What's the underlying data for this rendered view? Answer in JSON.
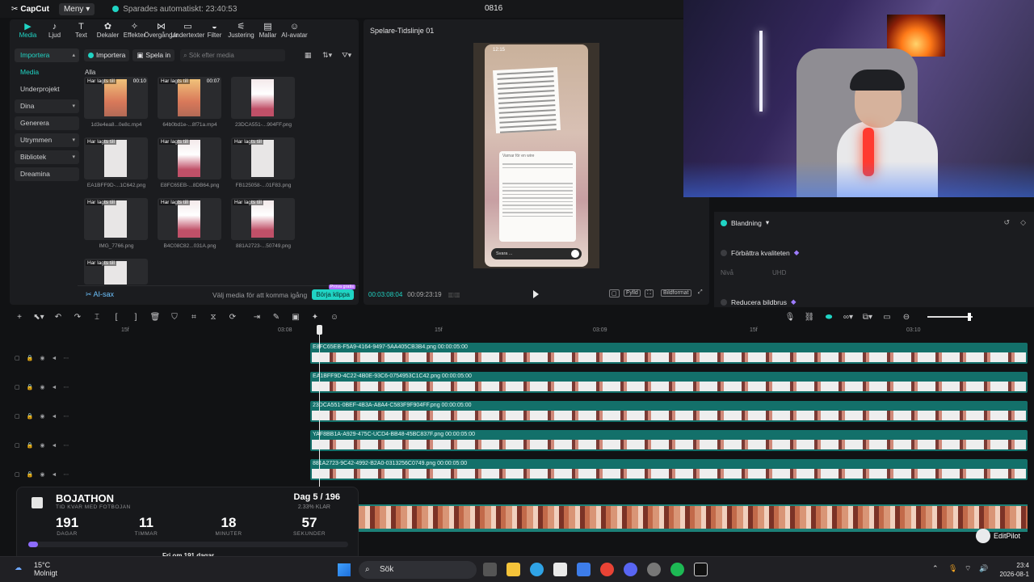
{
  "app": {
    "logo": "CapCut",
    "menu_label": "Meny",
    "autosave": "Sparades automatiskt: 23:40:53",
    "project_title": "0816"
  },
  "toolbar": [
    {
      "label": "Media",
      "icon": "media-icon",
      "active": true
    },
    {
      "label": "Ljud",
      "icon": "audio-icon"
    },
    {
      "label": "Text",
      "icon": "text-icon"
    },
    {
      "label": "Dekaler",
      "icon": "sticker-icon"
    },
    {
      "label": "Effekter",
      "icon": "effects-icon"
    },
    {
      "label": "Övergångar",
      "icon": "transitions-icon"
    },
    {
      "label": "Undertexter",
      "icon": "captions-icon"
    },
    {
      "label": "Filter",
      "icon": "filter-icon"
    },
    {
      "label": "Justering",
      "icon": "adjust-icon"
    },
    {
      "label": "Mallar",
      "icon": "templates-icon"
    },
    {
      "label": "AI-avatar",
      "icon": "avatar-icon"
    }
  ],
  "side_nav": [
    {
      "label": "Importera",
      "state": "open"
    },
    {
      "label": "Media",
      "state": "sel"
    },
    {
      "label": "Underprojekt",
      "state": ""
    },
    {
      "label": "Dina",
      "state": "boxed"
    },
    {
      "label": "Generera",
      "state": "boxed"
    },
    {
      "label": "Utrymmen",
      "state": "boxed"
    },
    {
      "label": "Bibliotek",
      "state": "boxed"
    },
    {
      "label": "Dreamina",
      "state": "boxed"
    }
  ],
  "media_bar": {
    "import_label": "Importera",
    "play_label": "Spela in",
    "search_placeholder": "Sök efter media",
    "group_label": "Alla"
  },
  "media_items": [
    {
      "tag": "Har lagts till",
      "duration": "00:10",
      "name": "1d3e4ea8...0e8c.mp4",
      "kind": "photo"
    },
    {
      "tag": "Har lagts till",
      "duration": "00:07",
      "name": "64b0bd1e-...8f71a.mp4",
      "kind": "photo"
    },
    {
      "tag": "",
      "duration": "",
      "name": "23DCA551-...904FF.png",
      "kind": "pink"
    },
    {
      "tag": "Har lagts till",
      "duration": "",
      "name": "EA1BFF9D-...1C642.png",
      "kind": "doc"
    },
    {
      "tag": "Har lagts till",
      "duration": "",
      "name": "E8FC65EB-...8DB64.png",
      "kind": "pink"
    },
    {
      "tag": "Har lagts till",
      "duration": "",
      "name": "FB125058-...01F83.png",
      "kind": "doc"
    },
    {
      "tag": "Har lagts till",
      "duration": "",
      "name": "IMG_7766.png",
      "kind": "doc"
    },
    {
      "tag": "Har lagts till",
      "duration": "",
      "name": "B4C08C82...031A.png",
      "kind": "pink"
    },
    {
      "tag": "Har lagts till",
      "duration": "",
      "name": "881A2723-...50749.png",
      "kind": "pink"
    },
    {
      "tag": "Har lagts till",
      "duration": "",
      "name": "",
      "kind": "doc"
    }
  ],
  "ai_bar": {
    "label": "AI-sax",
    "hint": "Välj media för att komma igång",
    "button": "Börja klippa",
    "badge": "Prova gratis"
  },
  "player": {
    "title": "Spelare-Tidslinje 01",
    "phone_time": "12:15",
    "chat_header": "Varnar för en wire",
    "reply_placeholder": "Svara ...",
    "time_current": "00:03:08:04",
    "time_total": "00:09:23:19",
    "ratio_label": "Bildformat",
    "full_label": "Fylld"
  },
  "props": {
    "blend_label": "Blandning",
    "enhance_label": "Förbättra kvaliteten",
    "level_label": "Nivå",
    "level_value": "UHD",
    "noise_label": "Reducera bildbrus"
  },
  "ruler": [
    "15f",
    "03:08",
    "15f",
    "03:09",
    "15f",
    "03:10"
  ],
  "tracks": [
    {
      "label": "E8FC65EB-F5A9-4164-9497-5AA405CB3B4.png  00:00:05:00"
    },
    {
      "label": "EA1BFF9D-4C22-4B0E-93C6-0754953C1C42.png  00:00:05:00"
    },
    {
      "label": "23DCA551-0BEF-4B3A-A8A4-C583F9F904FF.png  00:00:05:00"
    },
    {
      "label": "YAF8BB1A-A929-475C-UCD4-BB48-45BC837F.png  00:00:05:00"
    },
    {
      "label": "881A2723-9C42-4992-B2A0-0313256C0749.png  00:00:05:00"
    }
  ],
  "bojathon": {
    "title": "BOJATHON",
    "subtitle": "TID KVAR MED FOTBOJAN",
    "day": "Dag 5 / 196",
    "pct": "2.33% KLAR",
    "progress_fraction": 0.0233,
    "countdown": [
      {
        "value": "191",
        "unit": "DAGAR"
      },
      {
        "value": "11",
        "unit": "TIMMAR"
      },
      {
        "value": "18",
        "unit": "MINUTER"
      },
      {
        "value": "57",
        "unit": "SEKUNDER"
      }
    ],
    "footer": "Fri om 191 dagar"
  },
  "editpilot": {
    "label": "EditPilot"
  },
  "taskbar": {
    "temp": "15°C",
    "weather": "Molnigt",
    "search": "Sök",
    "time": "23:4",
    "date": "2026-08-1"
  }
}
